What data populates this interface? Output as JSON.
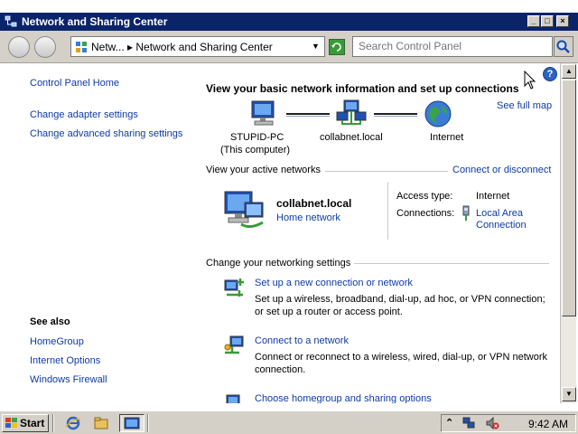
{
  "window": {
    "title": "Network and Sharing Center",
    "buttons": {
      "minimize": "_",
      "maximize": "□",
      "close": "×"
    }
  },
  "address_bar": {
    "breadcrumb_root": "Netw...",
    "breadcrumb_current": "Network and Sharing Center"
  },
  "search": {
    "placeholder": "Search Control Panel"
  },
  "sidebar": {
    "links": [
      "Control Panel Home",
      "Change adapter settings",
      "Change advanced sharing settings"
    ],
    "see_also_title": "See also",
    "see_also": [
      "HomeGroup",
      "Internet Options",
      "Windows Firewall"
    ]
  },
  "main": {
    "heading": "View your basic network information and set up connections",
    "see_full_map": "See full map",
    "map": {
      "computer_name": "STUPID-PC",
      "computer_sub": "(This computer)",
      "network_name": "collabnet.local",
      "internet": "Internet"
    },
    "active_networks_label": "View your active networks",
    "connect_disconnect": "Connect or disconnect",
    "active_network": {
      "name": "collabnet.local",
      "type_link": "Home network",
      "access_type_label": "Access type:",
      "access_type_value": "Internet",
      "connections_label": "Connections:",
      "connection_line1": "Local Area",
      "connection_line2": "Connection"
    },
    "change_settings_label": "Change your networking settings",
    "tasks": [
      {
        "title": "Set up a new connection or network",
        "desc1": "Set up a wireless, broadband, dial-up, ad hoc, or VPN connection;",
        "desc2": "or set up a router or access point."
      },
      {
        "title": "Connect to a network",
        "desc1": "Connect or reconnect to a wireless, wired, dial-up, or VPN network",
        "desc2": "connection."
      },
      {
        "title": "Choose homegroup and sharing options"
      }
    ]
  },
  "taskbar": {
    "start_label": "Start",
    "clock": "9:42 AM"
  },
  "colors": {
    "titlebar": "#0a246a",
    "link": "#0e3aa6",
    "chrome": "#d4d0c8"
  }
}
